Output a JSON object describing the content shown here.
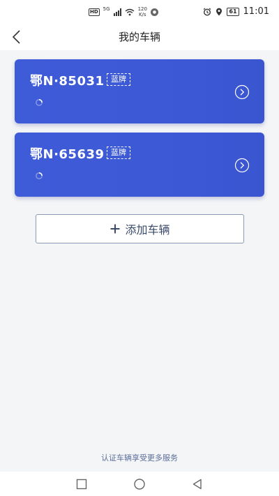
{
  "status_bar": {
    "hd": "HD",
    "network": "5G",
    "net_speed_value": "120",
    "net_speed_unit": "K/s",
    "battery": "61",
    "time": "11:01"
  },
  "header": {
    "title": "我的车辆"
  },
  "vehicles": [
    {
      "plate": "鄂N·85031",
      "tag": "蓝牌"
    },
    {
      "plate": "鄂N·65639",
      "tag": "蓝牌"
    }
  ],
  "add_vehicle": {
    "label": "添加车辆"
  },
  "footer": {
    "hint": "认证车辆享受更多服务"
  },
  "colors": {
    "card_blue": "#3e5bd8",
    "button_border": "#8c98b8",
    "hint_text": "#5b6e9a"
  }
}
